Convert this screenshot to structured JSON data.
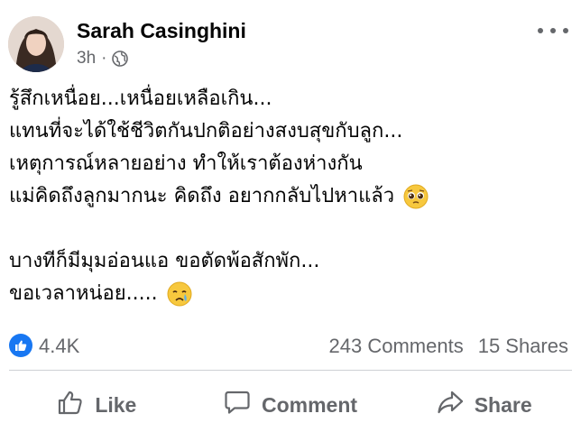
{
  "post": {
    "author": "Sarah Casinghini",
    "time": "3h",
    "separator": "·",
    "privacy_icon": "globe-icon",
    "more_icon": "more-dots-icon",
    "lines": [
      "รู้สึกเหนื่อย...เหนื่อยเหลือเกิน...",
      "แทนที่จะได้ใช้ชีวิตกันปกติอย่างสงบสุขกับลูก...",
      "เหตุการณ์หลายอย่าง ทำให้เราต้องห่างกัน",
      "แม่คิดถึงลูกมากนะ คิดถึง อยากกลับไปหาแล้ว",
      "",
      "บางทีก็มีมุมอ่อนแอ ขอตัดพ้อสักพัก...",
      "ขอเวลาหน่อย....."
    ],
    "emojis": {
      "line4": "pleading-face-emoji",
      "line7": "crying-face-emoji"
    }
  },
  "stats": {
    "reaction_icon": "like-reaction-icon",
    "likes": "4.4K",
    "comments": "243 Comments",
    "shares": "15 Shares"
  },
  "actions": {
    "like": "Like",
    "comment": "Comment",
    "share": "Share"
  },
  "colors": {
    "text": "#050505",
    "secondary": "#65676b",
    "accent": "#1877f2",
    "divider": "#ced0d4"
  }
}
